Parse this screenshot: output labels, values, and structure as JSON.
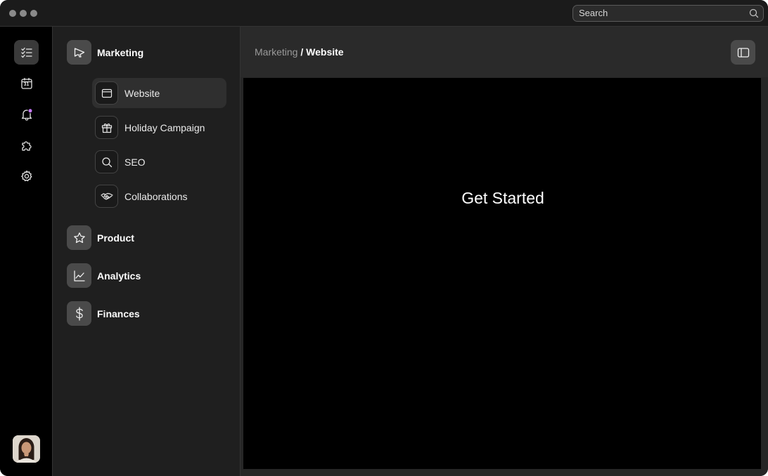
{
  "window": {
    "controls": [
      "window-dot-1",
      "window-dot-2",
      "window-dot-3"
    ]
  },
  "search": {
    "placeholder": "Search",
    "icon": "search-icon"
  },
  "rail": {
    "items": [
      {
        "icon": "checklist-icon",
        "active": true
      },
      {
        "icon": "calendar-icon",
        "badge_text": "31"
      },
      {
        "icon": "bell-icon",
        "badge_color": "#c879ff"
      },
      {
        "icon": "puzzle-icon"
      },
      {
        "icon": "gear-icon"
      }
    ],
    "avatar": "user-avatar"
  },
  "nav": {
    "sections": [
      {
        "label": "Marketing",
        "icon": "megaphone-icon",
        "expanded": true,
        "items": [
          {
            "label": "Website",
            "icon": "browser-window-icon",
            "active": true
          },
          {
            "label": "Holiday Campaign",
            "icon": "gift-icon"
          },
          {
            "label": "SEO",
            "icon": "search-icon"
          },
          {
            "label": "Collaborations",
            "icon": "handshake-icon"
          }
        ]
      },
      {
        "label": "Product",
        "icon": "star-icon"
      },
      {
        "label": "Analytics",
        "icon": "line-chart-icon"
      },
      {
        "label": "Finances",
        "icon": "dollar-icon"
      }
    ]
  },
  "main": {
    "breadcrumb": {
      "parent": "Marketing",
      "separator": " / ",
      "current": "Website"
    },
    "panel_toggle_icon": "sidebar-panel-icon",
    "content_text": "Get Started"
  },
  "colors": {
    "accent": "#c879ff",
    "background": "#1f1f1f",
    "canvas": "#000000"
  }
}
